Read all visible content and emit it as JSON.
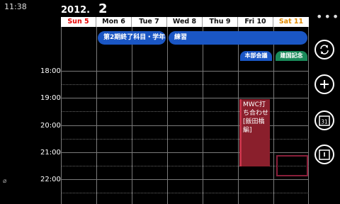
{
  "status": {
    "time": "11:38",
    "indicator": "⌀"
  },
  "header": {
    "year": "2012.",
    "month": "2"
  },
  "days": [
    {
      "label": "Sun 5",
      "color": "#e60000"
    },
    {
      "label": "Mon 6",
      "color": "#111111"
    },
    {
      "label": "Tue 7",
      "color": "#111111"
    },
    {
      "label": "Wed 8",
      "color": "#111111"
    },
    {
      "label": "Thu 9",
      "color": "#111111"
    },
    {
      "label": "Fri 10",
      "color": "#111111"
    },
    {
      "label": "Sat 11",
      "color": "#e08a00"
    }
  ],
  "time_labels": [
    "18:00",
    "19:00",
    "20:00",
    "21:00",
    "22:00"
  ],
  "allday_events": [
    {
      "title": "第2期終了科目・学年",
      "color": "#1a56c4"
    },
    {
      "title": "練習",
      "color": "#1a56c4"
    }
  ],
  "small_events": [
    {
      "title": "本部会議",
      "color": "#1a56c4"
    },
    {
      "title": "建国記念",
      "color": "#1a8a5a"
    }
  ],
  "timed_event": {
    "title": "MWC打ち合わせ[飯田橋編]",
    "line1": "MWC打",
    "line2": "ち合わせ",
    "line3": "[飯田橋編]"
  },
  "sidebar": {
    "more": "•••",
    "sync_icon": "sync-icon",
    "add_icon": "add-icon",
    "calendar_icon": "calendar-today-icon",
    "calendar_day": "31",
    "other_icon": "calendar-view-icon"
  }
}
